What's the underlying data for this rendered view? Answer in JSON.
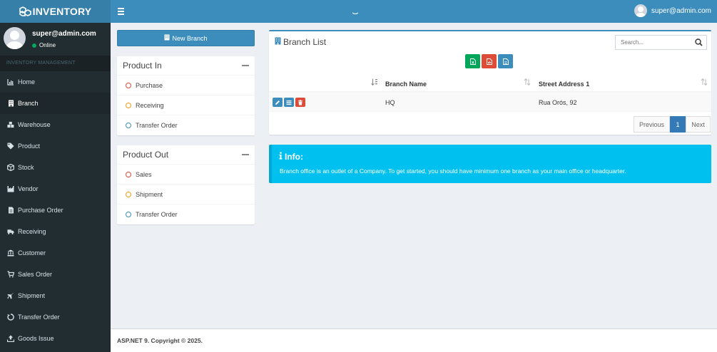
{
  "header": {
    "logo_text": "INVENTORY",
    "user_email": "super@admin.com",
    "brand_color": "#3c8dbc"
  },
  "sidebar": {
    "user_name": "super@admin.com",
    "user_status": "Online",
    "section_header": "INVENTORY MANAGEMENT",
    "items": [
      {
        "label": "Home",
        "icon": "chart-icon"
      },
      {
        "label": "Branch",
        "icon": "building-icon"
      },
      {
        "label": "Warehouse",
        "icon": "cubes-icon"
      },
      {
        "label": "Product",
        "icon": "tags-icon"
      },
      {
        "label": "Stock",
        "icon": "cube-icon"
      },
      {
        "label": "Vendor",
        "icon": "industry-icon"
      },
      {
        "label": "Purchase Order",
        "icon": "file-icon"
      },
      {
        "label": "Receiving",
        "icon": "truck-icon"
      },
      {
        "label": "Customer",
        "icon": "bank-icon"
      },
      {
        "label": "Sales Order",
        "icon": "cart-icon"
      },
      {
        "label": "Shipment",
        "icon": "plane-icon"
      },
      {
        "label": "Transfer Order",
        "icon": "recycle-icon"
      },
      {
        "label": "Goods Issue",
        "icon": "upload-icon"
      }
    ]
  },
  "new_branch_label": "New Branch",
  "product_in": {
    "title": "Product In",
    "items": [
      {
        "label": "Purchase",
        "color": "#dd4b39"
      },
      {
        "label": "Receiving",
        "color": "#f39c12"
      },
      {
        "label": "Transfer Order",
        "color": "#3c8dbc"
      }
    ]
  },
  "product_out": {
    "title": "Product Out",
    "items": [
      {
        "label": "Sales",
        "color": "#dd4b39"
      },
      {
        "label": "Shipment",
        "color": "#f39c12"
      },
      {
        "label": "Transfer Order",
        "color": "#3c8dbc"
      }
    ]
  },
  "branch_list": {
    "title": "Branch List",
    "search_placeholder": "Search...",
    "columns": [
      "Branch Name",
      "Street Address 1"
    ],
    "rows": [
      {
        "branch_name": "HQ",
        "street_address": "Rua Orós, 92"
      }
    ],
    "pagination": {
      "previous": "Previous",
      "current": "1",
      "next": "Next"
    }
  },
  "info": {
    "title": "Info:",
    "text": "Branch office is an outlet of a Company. To get started, you should have minimum one branch as your main office or headquarter."
  },
  "footer": {
    "text": "ASP.NET 9. Copyright © 2025."
  }
}
